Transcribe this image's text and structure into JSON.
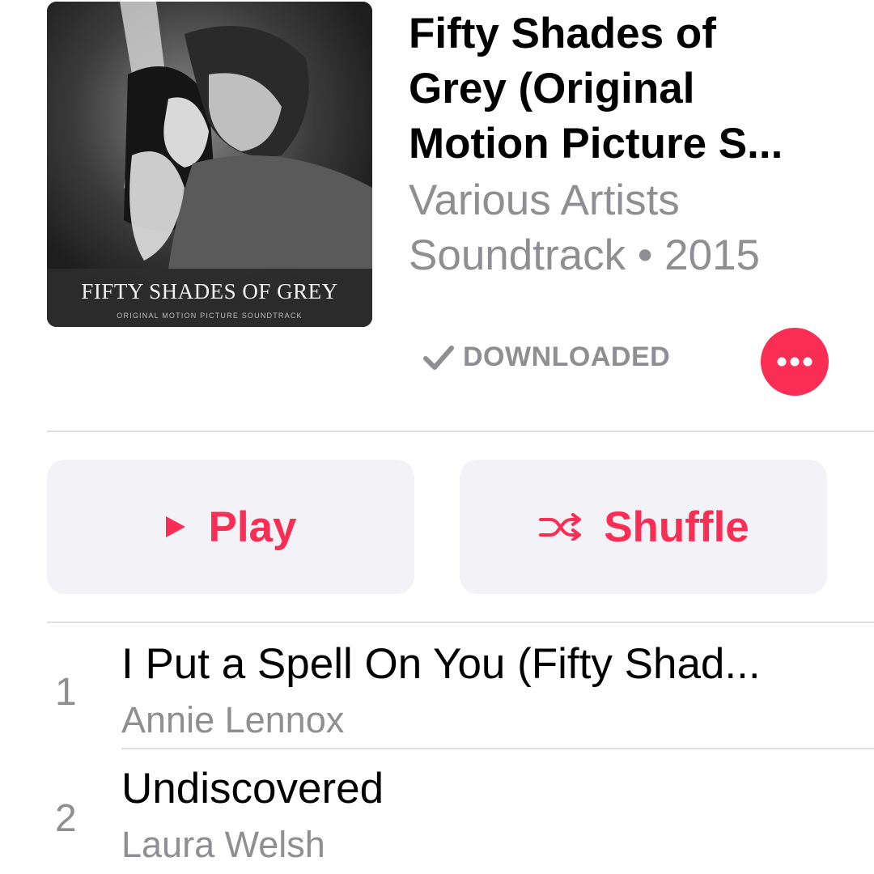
{
  "album": {
    "artwork_title": "FIFTY SHADES OF GREY",
    "artwork_subtitle": "ORIGINAL MOTION PICTURE SOUNDTRACK",
    "title_line1": "Fifty Shades of",
    "title_line2": "Grey (Original",
    "title_line3": "Motion Picture S...",
    "artist": "Various Artists",
    "meta": "Soundtrack • 2015",
    "download_status": "DOWNLOADED"
  },
  "actions": {
    "play_label": "Play",
    "shuffle_label": "Shuffle"
  },
  "colors": {
    "accent": "#fa2d55",
    "secondary_text": "#8e8e93",
    "button_bg": "#f2f2f7"
  },
  "icons": {
    "check": "checkmark-icon",
    "more": "more-icon",
    "play": "play-icon",
    "shuffle": "shuffle-icon"
  },
  "tracks": [
    {
      "number": "1",
      "title": "I Put a Spell On You (Fifty Shad...",
      "artist": "Annie Lennox"
    },
    {
      "number": "2",
      "title": "Undiscovered",
      "artist": "Laura Welsh"
    }
  ]
}
